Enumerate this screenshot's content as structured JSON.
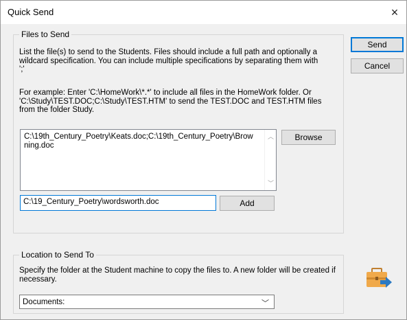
{
  "window": {
    "title": "Quick Send",
    "close_glyph": "×"
  },
  "files_group": {
    "title": "Files to Send",
    "instructions": "List the file(s) to send to the Students. Files should include a full path and optionally a wildcard specification. You can include multiple specifications by separating them with ';'",
    "example": "For example: Enter 'C:\\HomeWork\\*.*' to include all files in the HomeWork folder. Or 'C:\\Study\\TEST.DOC;C:\\Study\\TEST.HTM' to send the TEST.DOC and TEST.HTM files from the folder Study.",
    "file_list_value": "C:\\19th_Century_Poetry\\Keats.doc;C:\\19th_Century_Poetry\\Browning.doc",
    "browse_label": "Browse",
    "add_input_value": "C:\\19_Century_Poetry\\wordsworth.doc",
    "add_label": "Add"
  },
  "location_group": {
    "title": "Location to Send To",
    "instructions": "Specify the folder at the Student machine to copy the files to. A new folder will be created if necessary.",
    "selected_folder": "Documents:"
  },
  "actions": {
    "send_label": "Send",
    "cancel_label": "Cancel"
  },
  "icons": {
    "close": "close-icon",
    "briefcase": "briefcase-send-icon",
    "scroll_up": "scroll-up-arrow-icon",
    "scroll_down": "scroll-down-arrow-icon",
    "dropdown": "chevron-down-icon"
  },
  "colors": {
    "accent": "#0078d7",
    "briefcase": "#f0a94a",
    "send_arrow": "#2b79c2"
  }
}
